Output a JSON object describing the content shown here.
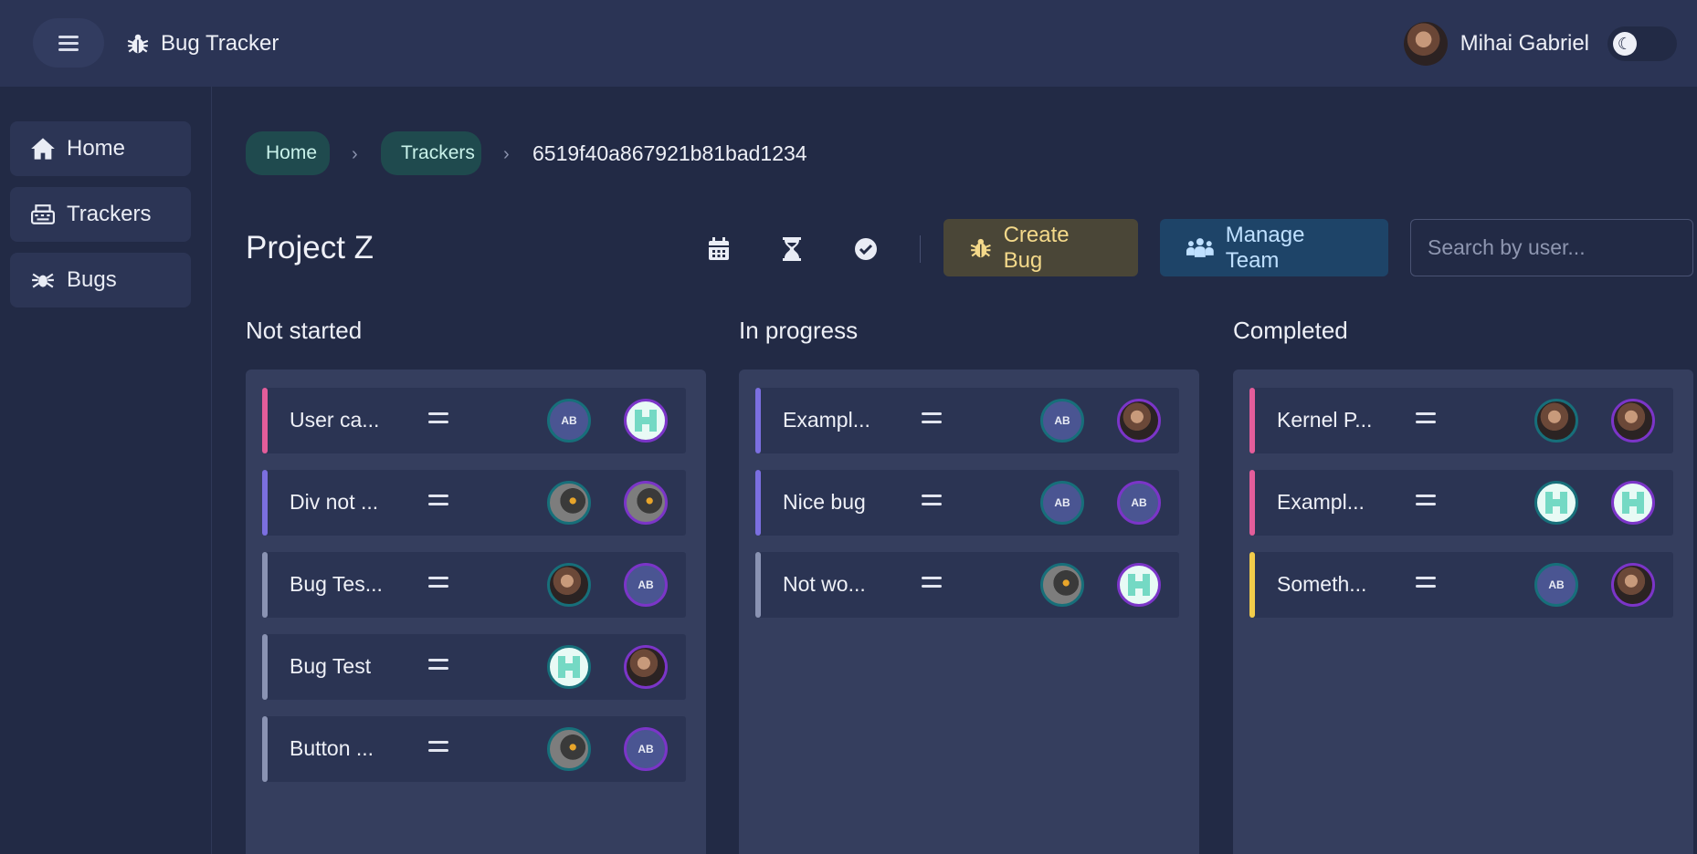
{
  "app": {
    "title": "Bug Tracker"
  },
  "user": {
    "name": "Mihai Gabriel"
  },
  "sidebar": {
    "items": [
      {
        "label": "Home",
        "icon": "home-icon"
      },
      {
        "label": "Trackers",
        "icon": "keyboard-icon"
      },
      {
        "label": "Bugs",
        "icon": "spider-icon"
      }
    ]
  },
  "breadcrumb": {
    "home": "Home",
    "trackers": "Trackers",
    "current": "6519f40a867921b81bad1234"
  },
  "project": {
    "title": "Project Z"
  },
  "toolbar": {
    "create_label": "Create Bug",
    "team_label": "Manage Team",
    "search_placeholder": "Search by user..."
  },
  "columns": [
    {
      "title": "Not started",
      "cards": [
        {
          "title": "User ca...",
          "color": "#e35d9a",
          "a1": "ab",
          "a2": "pix"
        },
        {
          "title": "Div not ...",
          "color": "#7b6fe0",
          "a1": "cat",
          "a2": "cat"
        },
        {
          "title": "Bug Tes...",
          "color": "#8a93b3",
          "a1": "photo",
          "a2": "ab"
        },
        {
          "title": "Bug Test",
          "color": "#8a93b3",
          "a1": "pix",
          "a2": "photo"
        },
        {
          "title": "Button ...",
          "color": "#8a93b3",
          "a1": "cat",
          "a2": "ab"
        }
      ]
    },
    {
      "title": "In progress",
      "cards": [
        {
          "title": "Exampl...",
          "color": "#7b6fe0",
          "a1": "ab",
          "a2": "photo"
        },
        {
          "title": "Nice bug",
          "color": "#7b6fe0",
          "a1": "ab",
          "a2": "ab"
        },
        {
          "title": "Not wo...",
          "color": "#8a93b3",
          "a1": "cat",
          "a2": "pix"
        }
      ]
    },
    {
      "title": "Completed",
      "cards": [
        {
          "title": "Kernel P...",
          "color": "#e35d9a",
          "a1": "photo",
          "a2": "photo"
        },
        {
          "title": "Exampl...",
          "color": "#e35d9a",
          "a1": "pix",
          "a2": "pix"
        },
        {
          "title": "Someth...",
          "color": "#f2cc4a",
          "a1": "ab",
          "a2": "photo"
        }
      ]
    }
  ],
  "avatar_initials": "AB"
}
